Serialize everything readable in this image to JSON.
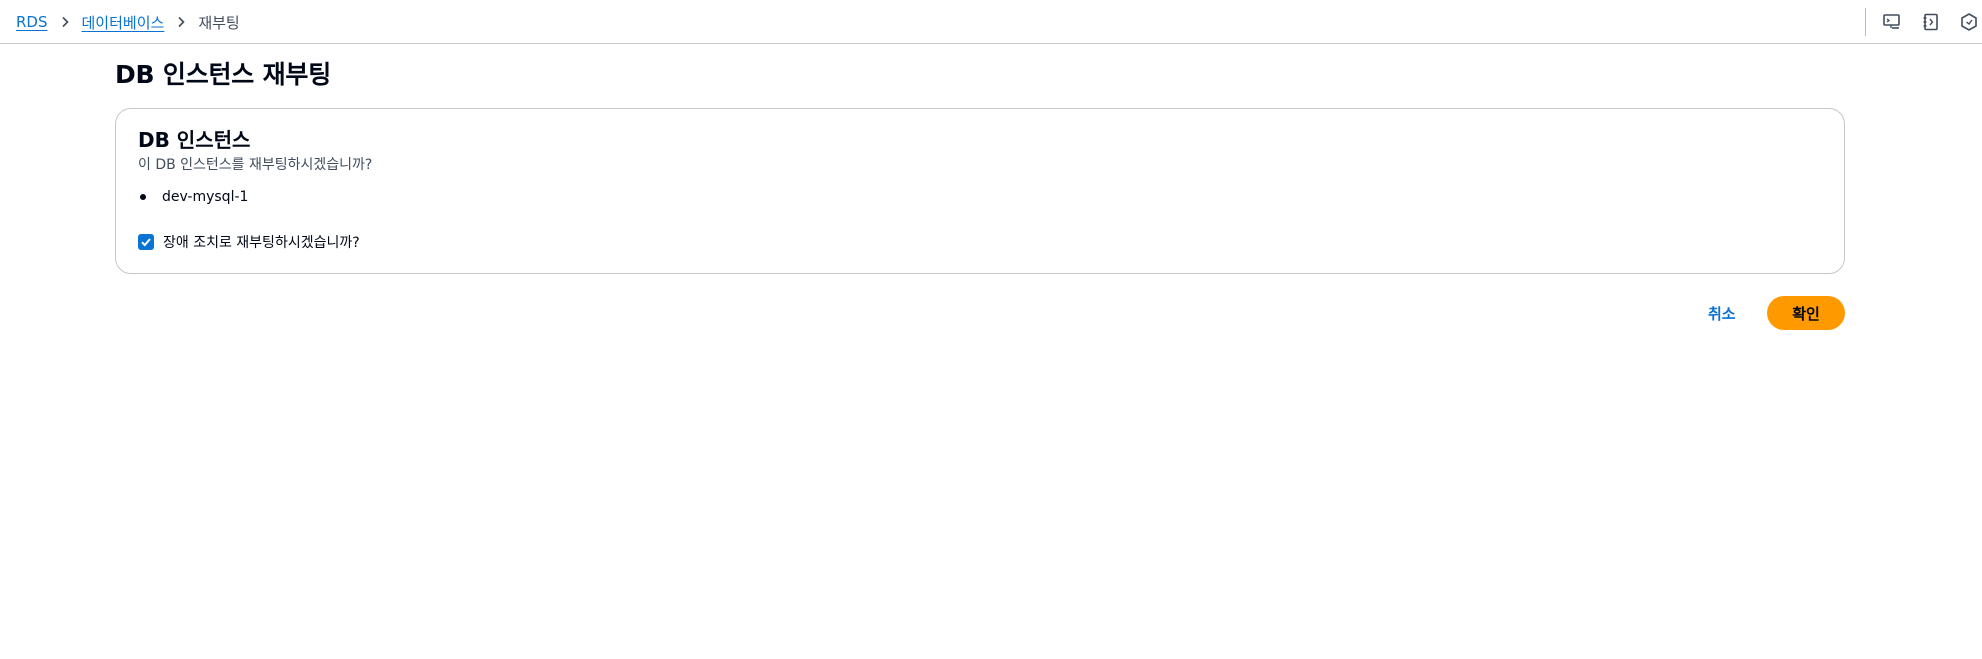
{
  "breadcrumb": {
    "items": [
      {
        "label": "RDS",
        "link": true
      },
      {
        "label": "데이터베이스",
        "link": true
      },
      {
        "label": "재부팅",
        "link": false
      }
    ]
  },
  "toolbar": {
    "icons": [
      "monitor-icon",
      "notebook-icon",
      "settings-hex-icon"
    ]
  },
  "page": {
    "title": "DB 인스턴스 재부팅"
  },
  "card": {
    "title": "DB 인스턴스",
    "description": "이 DB 인스턴스를 재부팅하시겠습니까?",
    "instances": [
      "dev-mysql-1"
    ],
    "failover_label": "장애 조치로 재부팅하시겠습니까?",
    "failover_checked": true
  },
  "actions": {
    "cancel_label": "취소",
    "confirm_label": "확인"
  },
  "colors": {
    "link": "#0972d3",
    "primary_button": "#ff9900",
    "checkbox": "#0972d3",
    "text": "#000716",
    "border": "#c6c6cd"
  }
}
